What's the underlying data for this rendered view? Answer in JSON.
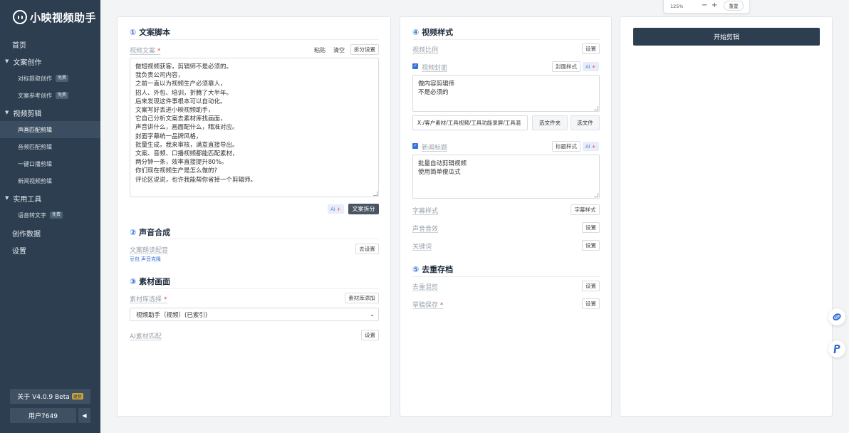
{
  "app": {
    "title": "小映视频助手"
  },
  "sidebar": {
    "home": "首页",
    "group1": {
      "label": "文案创作",
      "items": [
        {
          "label": "对标提取创作",
          "tag": "免费"
        },
        {
          "label": "文案参考创作",
          "tag": "免费"
        }
      ]
    },
    "group2": {
      "label": "视频剪辑",
      "items": [
        {
          "label": "声画匹配剪辑"
        },
        {
          "label": "音频匹配剪辑"
        },
        {
          "label": "一键口播剪辑"
        },
        {
          "label": "新闻视频剪辑"
        }
      ]
    },
    "group3": {
      "label": "实用工具",
      "items": [
        {
          "label": "语音转文字",
          "tag": "免费"
        }
      ]
    },
    "data": "创作数据",
    "settings": "设置",
    "about": "关于 V4.0.9 Beta",
    "about_badge": "更新",
    "user": "用户7649",
    "collapse_icon": "◀"
  },
  "zoom": {
    "value": "125%",
    "minus": "−",
    "plus": "+",
    "reset": "重置"
  },
  "panel1": {
    "s1_num": "①",
    "s1_title": "文案脚本",
    "script_label": "视频文案",
    "paste": "粘贴",
    "clear": "清空",
    "split_settings": "拆分设置",
    "script_text": "做短视频获客，剪辑师不是必须的。\n我负责公司内容，\n之前一直以为视频生产必须靠人，\n招人、外包、培训，折腾了大半年。\n后来发现这件事根本可以自动化。\n文案写好丢进小映视频助手，\n它自己分析文案去素材库找画面，\n声音讲什么，画面配什么，精准对应。\n封面字幕统一品牌风格，\n批量生成，我来审核，满意直接导出。\n文案、音频、口播视频都能匹配素材，\n两分钟一条，效率直接提升80%。\n你们现在视频生产是怎么做的?\n评论区说说，也许我能帮你省掉一个剪辑师。",
    "ai": "Ai",
    "split_btn": "文案拆分",
    "s2_num": "②",
    "s2_title": "声音合成",
    "voice_label": "文案朗读配音",
    "voice_btn": "去设置",
    "voice_link1": "豆包",
    "voice_link2": "声音克隆",
    "s3_num": "③",
    "s3_title": "素材画面",
    "lib_label": "素材库选择",
    "lib_btn": "素材库添加",
    "lib_value": "视频助手（视频）(已索引)",
    "ai_match_label": "AI素材匹配",
    "ai_match_btn": "设置"
  },
  "panel2": {
    "s4_num": "④",
    "s4_title": "视频样式",
    "ratio_label": "视频比例",
    "ratio_btn": "设置",
    "cover_label": "视频封面",
    "cover_style_btn": "封面样式",
    "ai": "Ai",
    "cover_text": "做内容剪辑师\n不是必须的",
    "path_value": "X:/客户素材/工具视频/工具功能录屏/工具混",
    "choose_folder": "选文件夹",
    "choose_file": "选文件",
    "news_label": "新闻标题",
    "title_style_btn": "标题样式",
    "news_text": "批量自动剪辑视频\n使用简单傻瓜式",
    "subtitle_label": "字幕样式",
    "subtitle_btn": "字幕样式",
    "sfx_label": "声音音效",
    "sfx_btn": "设置",
    "keyword_label": "关键词",
    "keyword_btn": "设置",
    "s5_num": "⑤",
    "s5_title": "去重存档",
    "dedup_label": "去重混剪",
    "dedup_btn": "设置",
    "draft_label": "草稿保存",
    "draft_btn": "设置"
  },
  "panel3": {
    "start_btn": "开始剪辑"
  }
}
